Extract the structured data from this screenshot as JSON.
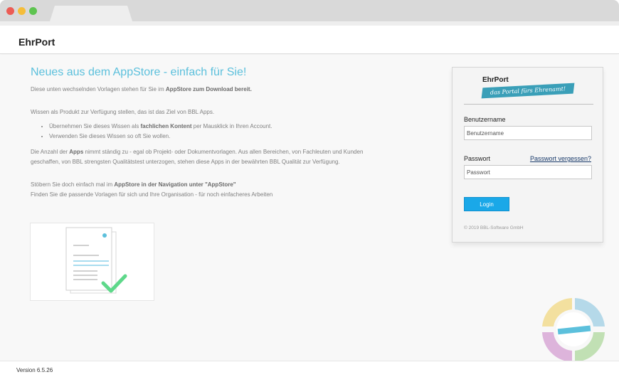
{
  "brand": "EhrPort",
  "main": {
    "headline": "Neues aus dem AppStore - einfach für Sie!",
    "intro_pre": "Diese unten wechselnden Vorlagen stehen für Sie im ",
    "intro_bold": "AppStore zum Download bereit.",
    "p2": "Wissen als Produkt zur Verfügung stellen, das ist das Ziel von BBL Apps.",
    "bullet1_pre": "Übernehmen Sie dieses Wissen als ",
    "bullet1_bold": "fachlichen Kontent",
    "bullet1_post": " per Mausklick in Ihren Account.",
    "bullet2": "Verwenden Sie dieses Wissen so oft Sie wollen.",
    "p3_pre": "Die Anzahl der ",
    "p3_bold": "Apps",
    "p3_post": " nimmt ständig zu - egal ob Projekt- oder Dokumentvorlagen. Aus allen Bereichen, von Fachleuten und Kunden geschaffen, von BBL strengsten Qualitätstest unterzogen, stehen diese Apps in der bewährten BBL Qualität zur Verfügung.",
    "p4_pre": "Stöbern Sie doch einfach mal im ",
    "p4_bold": "AppStore in der Navigation unter \"AppStore\"",
    "p4_line2": "Finden Sie die passende Vorlagen für sich und Ihre Organisation - für noch einfacheres Arbeiten"
  },
  "login": {
    "logo_title": "EhrPort",
    "logo_tagline": "das Portal fürs Ehrenamt!",
    "username_label": "Benutzername",
    "username_placeholder": "Benutzername",
    "password_label": "Passwort",
    "password_placeholder": "Passwort",
    "forgot": "Passwort vergessen?",
    "button": "Login",
    "copyright": "© 2019 BBL-Software GmbH"
  },
  "footer": {
    "version": "Version 6.5.26"
  },
  "colors": {
    "headline": "#5cc0dc",
    "login_button": "#1aa8e8",
    "logo_band": "#3a9fb8",
    "checkmark": "#5ed88a"
  },
  "icons": {
    "document": "document-with-checkmark-icon",
    "ring": "ehrport-cycle-icon"
  }
}
